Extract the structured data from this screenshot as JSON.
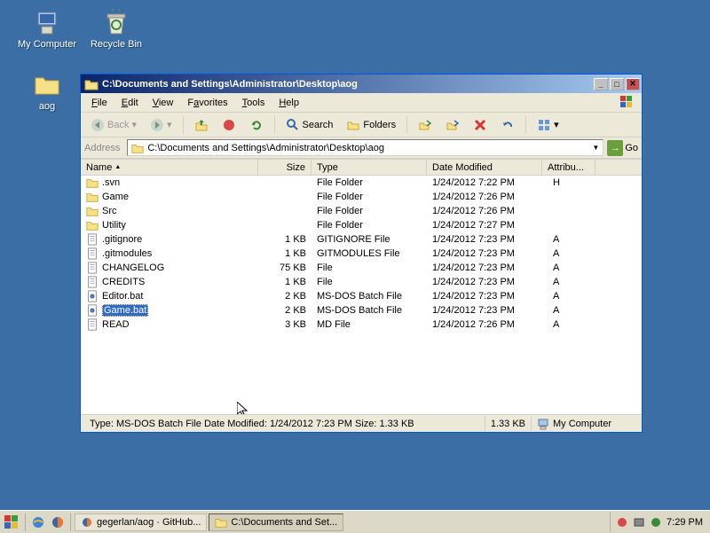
{
  "desktop": {
    "icons": [
      {
        "name": "my-computer",
        "label": "My Computer"
      },
      {
        "name": "recycle-bin",
        "label": "Recycle Bin"
      },
      {
        "name": "aog-folder",
        "label": "aog"
      }
    ]
  },
  "window": {
    "title": "C:\\Documents and Settings\\Administrator\\Desktop\\aog",
    "menu": {
      "file": "File",
      "edit": "Edit",
      "view": "View",
      "favorites": "Favorites",
      "tools": "Tools",
      "help": "Help"
    },
    "toolbar": {
      "back": "Back",
      "search": "Search",
      "folders": "Folders"
    },
    "address": {
      "label": "Address",
      "value": "C:\\Documents and Settings\\Administrator\\Desktop\\aog",
      "go": "Go"
    },
    "columns": {
      "name": "Name",
      "size": "Size",
      "type": "Type",
      "date": "Date Modified",
      "attr": "Attribu..."
    },
    "files": [
      {
        "icon": "folder",
        "name": ".svn",
        "size": "",
        "type": "File Folder",
        "date": "1/24/2012 7:22 PM",
        "attr": "H"
      },
      {
        "icon": "folder",
        "name": "Game",
        "size": "",
        "type": "File Folder",
        "date": "1/24/2012 7:26 PM",
        "attr": ""
      },
      {
        "icon": "folder",
        "name": "Src",
        "size": "",
        "type": "File Folder",
        "date": "1/24/2012 7:26 PM",
        "attr": ""
      },
      {
        "icon": "folder",
        "name": "Utility",
        "size": "",
        "type": "File Folder",
        "date": "1/24/2012 7:27 PM",
        "attr": ""
      },
      {
        "icon": "file",
        "name": ".gitignore",
        "size": "1 KB",
        "type": "GITIGNORE File",
        "date": "1/24/2012 7:23 PM",
        "attr": "A"
      },
      {
        "icon": "file",
        "name": ".gitmodules",
        "size": "1 KB",
        "type": "GITMODULES File",
        "date": "1/24/2012 7:23 PM",
        "attr": "A"
      },
      {
        "icon": "file",
        "name": "CHANGELOG",
        "size": "75 KB",
        "type": "File",
        "date": "1/24/2012 7:23 PM",
        "attr": "A"
      },
      {
        "icon": "file",
        "name": "CREDITS",
        "size": "1 KB",
        "type": "File",
        "date": "1/24/2012 7:23 PM",
        "attr": "A"
      },
      {
        "icon": "bat",
        "name": "Editor.bat",
        "size": "2 KB",
        "type": "MS-DOS Batch File",
        "date": "1/24/2012 7:23 PM",
        "attr": "A"
      },
      {
        "icon": "bat",
        "name": "Game.bat",
        "size": "2 KB",
        "type": "MS-DOS Batch File",
        "date": "1/24/2012 7:23 PM",
        "attr": "A",
        "selected": true
      },
      {
        "icon": "file",
        "name": "README.md",
        "size": "3 KB",
        "type": "MD File",
        "date": "1/24/2012 7:26 PM",
        "attr": "A"
      }
    ],
    "tooltip": {
      "line1": "Type: MS-DOS Batch File",
      "line2": "Date Modified: 1/24/2012 7:23 PM",
      "line3": "Size: 1.33 KB"
    },
    "status": {
      "main": "Type: MS-DOS Batch File Date Modified: 1/24/2012 7:23 PM Size: 1.33 KB",
      "size": "1.33 KB",
      "location": "My Computer"
    }
  },
  "taskbar": {
    "tasks": [
      {
        "label": "gegerlan/aog · GitHub...",
        "icon": "firefox"
      },
      {
        "label": "C:\\Documents and Set...",
        "icon": "folder",
        "active": true
      }
    ],
    "clock": "7:29 PM"
  }
}
